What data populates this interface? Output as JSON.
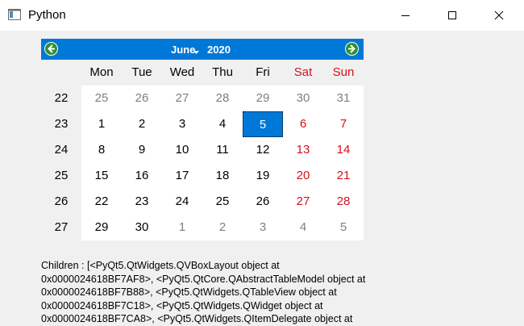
{
  "window": {
    "title": "Python"
  },
  "calendar": {
    "month": "June",
    "year": "2020",
    "weekdays": [
      {
        "label": "Mon",
        "weekend": false
      },
      {
        "label": "Tue",
        "weekend": false
      },
      {
        "label": "Wed",
        "weekend": false
      },
      {
        "label": "Thu",
        "weekend": false
      },
      {
        "label": "Fri",
        "weekend": false
      },
      {
        "label": "Sat",
        "weekend": true
      },
      {
        "label": "Sun",
        "weekend": true
      }
    ],
    "weeks": [
      {
        "number": "22",
        "days": [
          {
            "d": "25",
            "other": true
          },
          {
            "d": "26",
            "other": true
          },
          {
            "d": "27",
            "other": true
          },
          {
            "d": "28",
            "other": true
          },
          {
            "d": "29",
            "other": true
          },
          {
            "d": "30",
            "other": true
          },
          {
            "d": "31",
            "other": true
          }
        ]
      },
      {
        "number": "23",
        "days": [
          {
            "d": "1"
          },
          {
            "d": "2"
          },
          {
            "d": "3"
          },
          {
            "d": "4"
          },
          {
            "d": "5",
            "selected": true
          },
          {
            "d": "6"
          },
          {
            "d": "7"
          }
        ]
      },
      {
        "number": "24",
        "days": [
          {
            "d": "8"
          },
          {
            "d": "9"
          },
          {
            "d": "10"
          },
          {
            "d": "11"
          },
          {
            "d": "12"
          },
          {
            "d": "13"
          },
          {
            "d": "14"
          }
        ]
      },
      {
        "number": "25",
        "days": [
          {
            "d": "15"
          },
          {
            "d": "16"
          },
          {
            "d": "17"
          },
          {
            "d": "18"
          },
          {
            "d": "19"
          },
          {
            "d": "20"
          },
          {
            "d": "21"
          }
        ]
      },
      {
        "number": "26",
        "days": [
          {
            "d": "22"
          },
          {
            "d": "23"
          },
          {
            "d": "24"
          },
          {
            "d": "25"
          },
          {
            "d": "26"
          },
          {
            "d": "27"
          },
          {
            "d": "28"
          }
        ]
      },
      {
        "number": "27",
        "days": [
          {
            "d": "29"
          },
          {
            "d": "30"
          },
          {
            "d": "1",
            "other": true
          },
          {
            "d": "2",
            "other": true
          },
          {
            "d": "3",
            "other": true
          },
          {
            "d": "4",
            "other": true
          },
          {
            "d": "5",
            "other": true
          }
        ]
      }
    ]
  },
  "children_label": {
    "lines": [
      "Children : [<PyQt5.QtWidgets.QVBoxLayout object at",
      "0x0000024618BF7AF8>, <PyQt5.QtCore.QAbstractTableModel object at",
      "0x0000024618BF7B88>, <PyQt5.QtWidgets.QTableView object at",
      "0x0000024618BF7C18>, <PyQt5.QtWidgets.QWidget object at",
      "0x0000024618BF7CA8>, <PyQt5.QtWidgets.QItemDelegate object at"
    ]
  },
  "colors": {
    "accent": "#0078d7",
    "weekend": "#d4101f",
    "other_month": "#808080"
  }
}
